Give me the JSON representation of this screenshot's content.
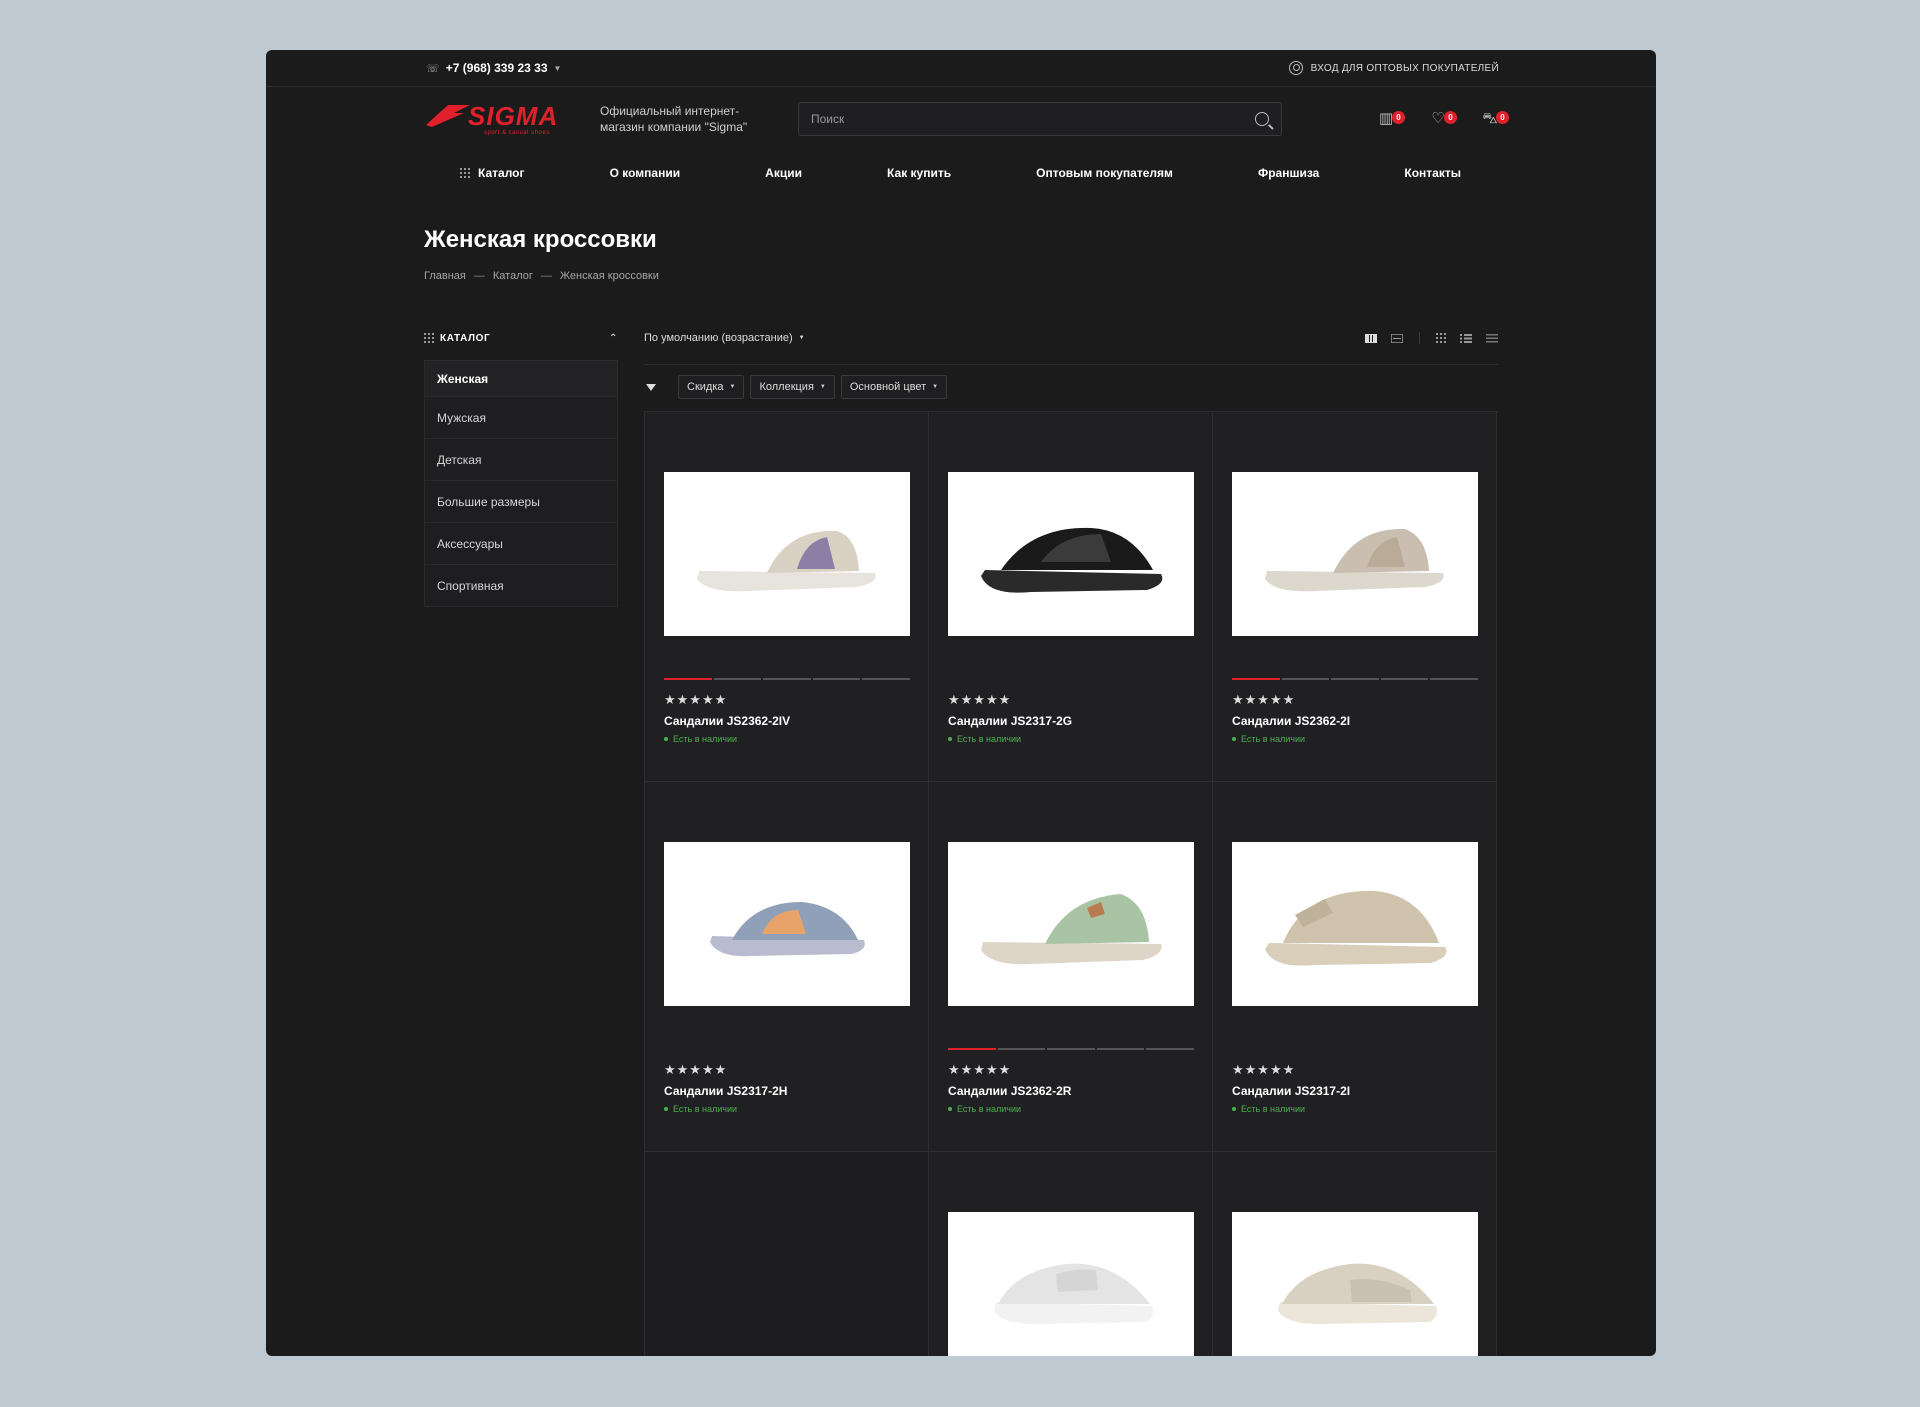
{
  "topbar": {
    "phone": "+7 (968) 339 23 33",
    "login": "ВХОД ДЛЯ ОПТОВЫХ ПОКУПАТЕЛЕЙ"
  },
  "header": {
    "logo_word": "SIGMA",
    "logo_sub": "sport & casual shoes",
    "tagline": "Официальный интернет-магазин компании \"Sigma\"",
    "search_placeholder": "Поиск",
    "compare_count": "0",
    "favorites_count": "0",
    "cart_count": "0"
  },
  "nav": [
    "Каталог",
    "О компании",
    "Акции",
    "Как купить",
    "Оптовым покупателям",
    "Франшиза",
    "Контакты"
  ],
  "page": {
    "title": "Женская кроссовки",
    "breadcrumb": [
      "Главная",
      "Каталог",
      "Женская кроссовки"
    ]
  },
  "sidebar": {
    "heading": "КАТАЛОГ",
    "items": [
      "Женская",
      "Мужская",
      "Детская",
      "Большие размеры",
      "Аксессуары",
      "Спортивная"
    ]
  },
  "sort": {
    "label": "По умолчанию (возрастание)"
  },
  "filters": [
    "Скидка",
    "Коллекция",
    "Основной цвет"
  ],
  "products": [
    {
      "title": "Сандалии JS2362-2IV",
      "stock": "Есть в наличии",
      "stars": "★★★★★",
      "colors": [
        "#e7e4de",
        "#d9d2c4",
        "#8b7fa6"
      ]
    },
    {
      "title": "Сандалии JS2317-2G",
      "stock": "Есть в наличии",
      "stars": "★★★★★",
      "colors": [
        "#2a2a2a",
        "#1a1a1a",
        "#3b3b3b"
      ]
    },
    {
      "title": "Сандалии JS2362-2I",
      "stock": "Есть в наличии",
      "stars": "★★★★★",
      "colors": [
        "#ddd8ce",
        "#c9beaf",
        "#b9ab98"
      ]
    },
    {
      "title": "Сандалии JS2317-2H",
      "stock": "Есть в наличии",
      "stars": "★★★★★",
      "colors": [
        "#b9bccf",
        "#8fa0b8",
        "#e8a36b"
      ]
    },
    {
      "title": "Сандалии JS2362-2R",
      "stock": "Есть в наличии",
      "stars": "★★★★★",
      "colors": [
        "#ddd6c8",
        "#a9c4a4",
        "#b97b4f"
      ]
    },
    {
      "title": "Сандалии JS2317-2I",
      "stock": "Есть в наличии",
      "stars": "★★★★★",
      "colors": [
        "#d8ceba",
        "#cfc3ad",
        "#bfb29a"
      ]
    }
  ],
  "bottom_row_colors": [
    [
      "#f2f2f2",
      "#e4e4e4",
      "#d5d5d5"
    ],
    [
      "#ece6da",
      "#d8d0c0",
      "#c8c0b0"
    ]
  ],
  "colors": {
    "accent": "#e0202b",
    "bg": "#1b1b1c",
    "in_stock": "#4caf50"
  }
}
